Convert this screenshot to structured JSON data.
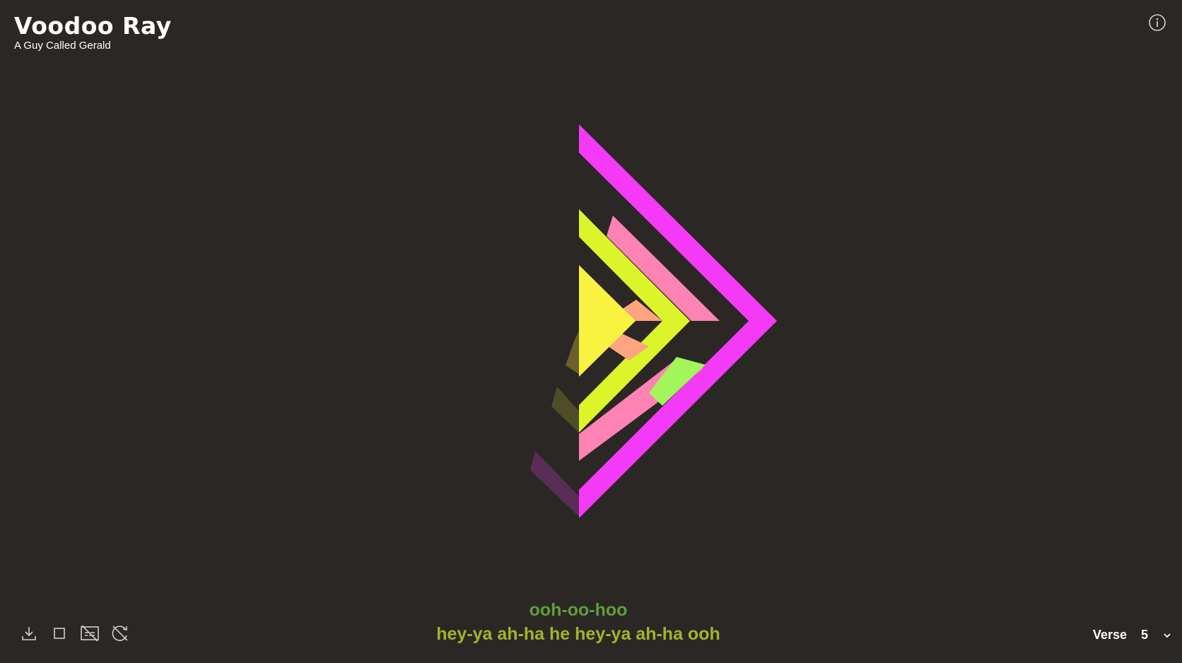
{
  "song": {
    "title": "Voodoo Ray",
    "artist": "A Guy Called Gerald"
  },
  "lyrics": {
    "previous": "ooh-oo-hoo",
    "current": "hey-ya ah-ha he hey-ya ah-ha ooh"
  },
  "toolbar": [
    {
      "icon": "download-icon"
    },
    {
      "icon": "square-icon"
    },
    {
      "icon": "captions-off-icon"
    },
    {
      "icon": "autoplay-off-icon"
    }
  ],
  "section_selector": {
    "label": "Verse",
    "value": "5"
  },
  "colors": {
    "background": "#2b2725",
    "magenta": "#f53af7",
    "pink": "#ff82b4",
    "lime": "#dbf52a",
    "yellow": "#f8f240",
    "peach": "#ffa47f",
    "green": "#a2f55a",
    "lyric_prev": "#5f9e38",
    "lyric_current": "#a2b42a"
  }
}
